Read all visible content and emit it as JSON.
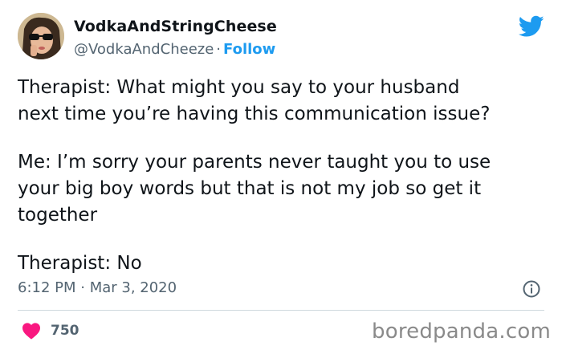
{
  "author": {
    "display_name": "VodkaAndStringCheese",
    "handle": "@VodkaAndCheeze",
    "separator": "·",
    "follow_label": "Follow"
  },
  "tweet": {
    "lines_1": [
      "Therapist: What might you say to your husband",
      "next time you’re having this communication issue?"
    ],
    "lines_2": [
      "Me: I’m sorry your parents never taught you to use",
      "your big boy words but that is not my job so get it",
      "together"
    ],
    "lines_3": [
      "Therapist: No"
    ],
    "timestamp": "6:12 PM · Mar 3, 2020"
  },
  "engagement": {
    "like_count": "750"
  },
  "watermark": "boredpanda.com",
  "colors": {
    "twitter_blue": "#1d9bf0",
    "like_red": "#f91880",
    "secondary_text": "#536471"
  },
  "icons": [
    "twitter-bird-icon",
    "info-icon",
    "heart-icon"
  ]
}
